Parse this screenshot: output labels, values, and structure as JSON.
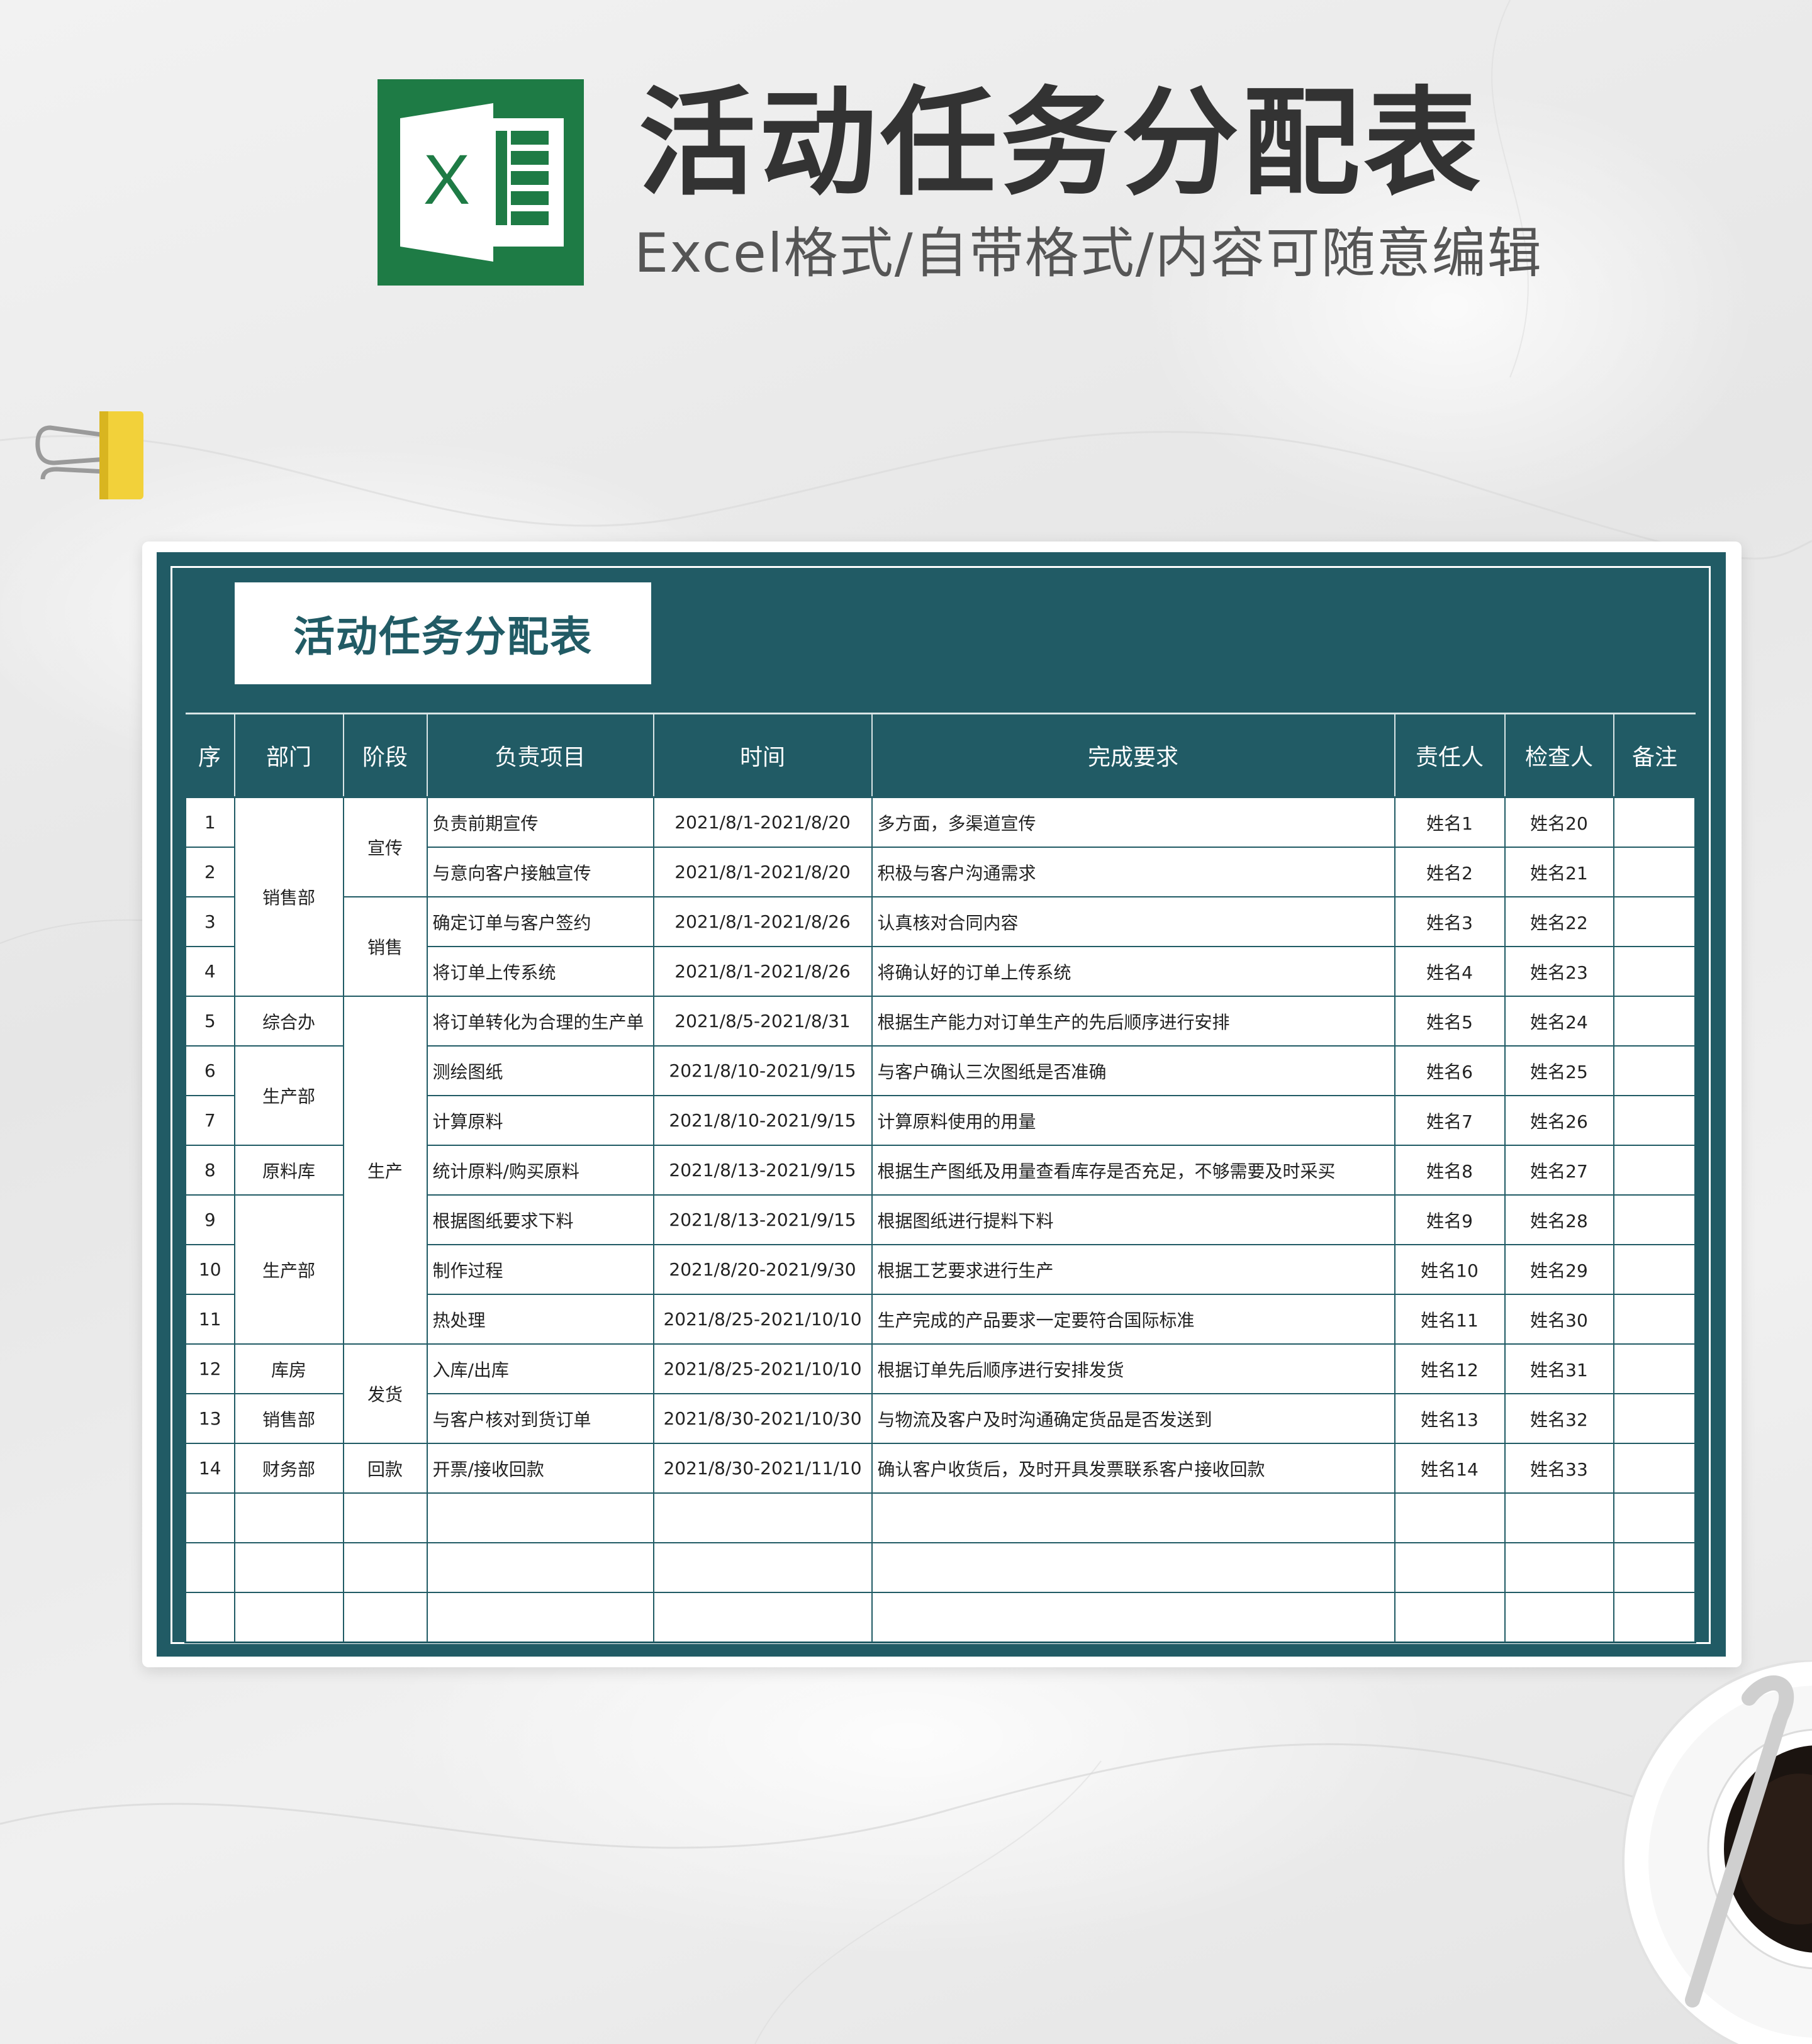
{
  "header": {
    "title": "活动任务分配表",
    "subtitle": "Excel格式/自带格式/内容可随意编辑",
    "logo_letter": "X"
  },
  "sheet": {
    "title": "活动任务分配表",
    "columns": [
      "序",
      "部门",
      "阶段",
      "负责项目",
      "时间",
      "完成要求",
      "责任人",
      "检查人",
      "备注"
    ],
    "rows": [
      {
        "no": "1",
        "item": "负责前期宣传",
        "time": "2021/8/1-2021/8/20",
        "req": "多方面，多渠道宣传",
        "owner": "姓名1",
        "checker": "姓名20",
        "note": ""
      },
      {
        "no": "2",
        "item": "与意向客户接触宣传",
        "time": "2021/8/1-2021/8/20",
        "req": "积极与客户沟通需求",
        "owner": "姓名2",
        "checker": "姓名21",
        "note": ""
      },
      {
        "no": "3",
        "item": "确定订单与客户签约",
        "time": "2021/8/1-2021/8/26",
        "req": "认真核对合同内容",
        "owner": "姓名3",
        "checker": "姓名22",
        "note": ""
      },
      {
        "no": "4",
        "item": "将订单上传系统",
        "time": "2021/8/1-2021/8/26",
        "req": "将确认好的订单上传系统",
        "owner": "姓名4",
        "checker": "姓名23",
        "note": ""
      },
      {
        "no": "5",
        "item": "将订单转化为合理的生产单",
        "time": "2021/8/5-2021/8/31",
        "req": "根据生产能力对订单生产的先后顺序进行安排",
        "owner": "姓名5",
        "checker": "姓名24",
        "note": ""
      },
      {
        "no": "6",
        "item": "测绘图纸",
        "time": "2021/8/10-2021/9/15",
        "req": "与客户确认三次图纸是否准确",
        "owner": "姓名6",
        "checker": "姓名25",
        "note": ""
      },
      {
        "no": "7",
        "item": "计算原料",
        "time": "2021/8/10-2021/9/15",
        "req": "计算原料使用的用量",
        "owner": "姓名7",
        "checker": "姓名26",
        "note": ""
      },
      {
        "no": "8",
        "item": "统计原料/购买原料",
        "time": "2021/8/13-2021/9/15",
        "req": "根据生产图纸及用量查看库存是否充足，不够需要及时采买",
        "owner": "姓名8",
        "checker": "姓名27",
        "note": ""
      },
      {
        "no": "9",
        "item": "根据图纸要求下料",
        "time": "2021/8/13-2021/9/15",
        "req": "根据图纸进行提料下料",
        "owner": "姓名9",
        "checker": "姓名28",
        "note": ""
      },
      {
        "no": "10",
        "item": "制作过程",
        "time": "2021/8/20-2021/9/30",
        "req": "根据工艺要求进行生产",
        "owner": "姓名10",
        "checker": "姓名29",
        "note": ""
      },
      {
        "no": "11",
        "item": "热处理",
        "time": "2021/8/25-2021/10/10",
        "req": "生产完成的产品要求一定要符合国际标准",
        "owner": "姓名11",
        "checker": "姓名30",
        "note": ""
      },
      {
        "no": "12",
        "item": "入库/出库",
        "time": "2021/8/25-2021/10/10",
        "req": "根据订单先后顺序进行安排发货",
        "owner": "姓名12",
        "checker": "姓名31",
        "note": ""
      },
      {
        "no": "13",
        "item": "与客户核对到货订单",
        "time": "2021/8/30-2021/10/30",
        "req": "与物流及客户及时沟通确定货品是否发送到",
        "owner": "姓名13",
        "checker": "姓名32",
        "note": ""
      },
      {
        "no": "14",
        "item": "开票/接收回款",
        "time": "2021/8/30-2021/11/10",
        "req": "确认客户收货后，及时开具发票联系客户接收回款",
        "owner": "姓名14",
        "checker": "姓名33",
        "note": ""
      }
    ],
    "departments": [
      {
        "start": 0,
        "span": 4,
        "label": "销售部"
      },
      {
        "start": 4,
        "span": 1,
        "label": "综合办"
      },
      {
        "start": 5,
        "span": 2,
        "label": "生产部"
      },
      {
        "start": 7,
        "span": 1,
        "label": "原料库"
      },
      {
        "start": 8,
        "span": 3,
        "label": "生产部"
      },
      {
        "start": 11,
        "span": 1,
        "label": "库房"
      },
      {
        "start": 12,
        "span": 1,
        "label": "销售部"
      },
      {
        "start": 13,
        "span": 1,
        "label": "财务部"
      }
    ],
    "stages": [
      {
        "start": 0,
        "span": 2,
        "label": "宣传"
      },
      {
        "start": 2,
        "span": 2,
        "label": "销售"
      },
      {
        "start": 4,
        "span": 7,
        "label": "生产"
      },
      {
        "start": 11,
        "span": 2,
        "label": "发货"
      },
      {
        "start": 13,
        "span": 1,
        "label": "回款"
      }
    ],
    "empty_rows": 3
  },
  "colors": {
    "teal": "#215b65",
    "excel_green": "#1e7b45",
    "clip_yellow": "#f2d13a"
  }
}
